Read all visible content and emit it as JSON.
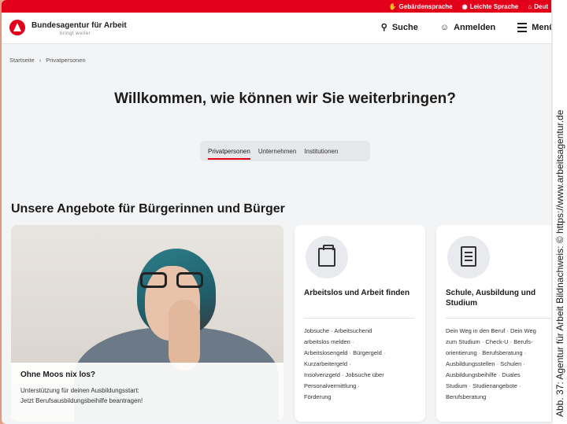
{
  "topbar": {
    "items": [
      {
        "icon": "hand-icon",
        "label": "Gebärdensprache"
      },
      {
        "icon": "easy-language-icon",
        "label": "Leichte Sprache"
      },
      {
        "icon": "language-icon",
        "label": "Deut"
      }
    ]
  },
  "header": {
    "logo_text": "Bundesagentur für Arbeit",
    "logo_sub": "bringt weiter",
    "search_label": "Suche",
    "login_label": "Anmelden",
    "menu_label": "Menü"
  },
  "breadcrumb": {
    "home": "Startseite",
    "current": "Privatpersonen"
  },
  "hero": {
    "title": "Willkommen, wie können wir Sie weiterbringen?"
  },
  "tabs": [
    {
      "label": "Privatpersonen",
      "active": true
    },
    {
      "label": "Unternehmen",
      "active": false
    },
    {
      "label": "Institutionen",
      "active": false
    }
  ],
  "section": {
    "title": "Unsere Angebote für Bürgerinnen und Bürger"
  },
  "promo": {
    "title": "Ohne Moos nix los?",
    "line1": "Unterstützung für deinen Ausbildungsstart:",
    "line2": "Jetzt Berufsausbildungsbeihilfe beantragen!"
  },
  "tiles": [
    {
      "title": "Arbeitslos und Arbeit finden",
      "icon": "briefcase-icon",
      "links": [
        "Jobsuche · Arbeitsuchend",
        "arbeitslos melden ·",
        "Arbeitslosengeld · Bürgergeld ·",
        "Kurzarbeitergeld ·",
        "Insolvenzgeld · Jobsuche über",
        "Personalvermittlung ·",
        "Förderung"
      ]
    },
    {
      "title": "Schule, Ausbildung und Studium",
      "icon": "document-icon",
      "links": [
        "Dein Weg in den Beruf · Dein Weg",
        "zum Studium · Check-U · Berufs-",
        "orientierung · Berufsberatung ·",
        "Ausbildungsstellen · Schulen ·",
        "Ausbildungsbeihilfe · Duales",
        "Studium · Studienangebote ·",
        "Berufsberatung"
      ]
    }
  ],
  "credit": "Abb. 37: Agentur für Arbeit Bildnachweis: © https://www.arbeitsagentur.de",
  "colors": {
    "brand_red": "#e2001a",
    "page_bg": "#f3f4f6"
  }
}
